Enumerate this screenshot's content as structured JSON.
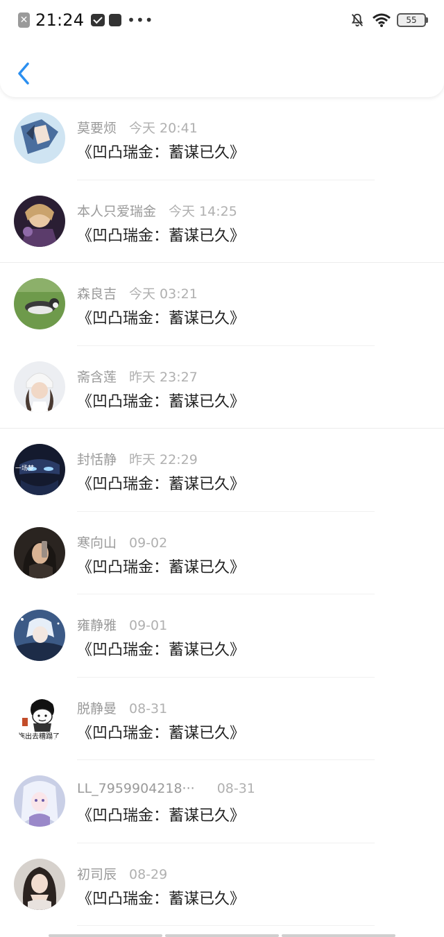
{
  "status_bar": {
    "time": "21:24",
    "battery": "55"
  },
  "header": {
    "back_icon": "chevron-left-icon",
    "accent_color": "#2b8ff0"
  },
  "comments": [
    {
      "name": "莫要烦",
      "date": "今天 20:41",
      "content": "《凹凸瑞金：蓄谋已久》"
    },
    {
      "name": "本人只爱瑞金",
      "date": "今天 14:25",
      "content": "《凹凸瑞金：蓄谋已久》"
    },
    {
      "name": "森良吉",
      "date": "今天 03:21",
      "content": "《凹凸瑞金：蓄谋已久》"
    },
    {
      "name": "斋含莲",
      "date": "昨天 23:27",
      "content": "《凹凸瑞金：蓄谋已久》"
    },
    {
      "name": "封恬静",
      "date": "昨天 22:29",
      "content": "《凹凸瑞金：蓄谋已久》",
      "avatar_text": "一场梦"
    },
    {
      "name": "寒向山",
      "date": "09-02",
      "content": "《凹凸瑞金：蓄谋已久》"
    },
    {
      "name": "雍静雅",
      "date": "09-01",
      "content": "《凹凸瑞金：蓄谋已久》"
    },
    {
      "name": "脱静曼",
      "date": "08-31",
      "content": "《凹凸瑞金：蓄谋已久》",
      "avatar_text": "拖出去糟蹋了"
    },
    {
      "name": "LL_7959904218···",
      "date": "08-31",
      "content": "《凹凸瑞金：蓄谋已久》"
    },
    {
      "name": "初司辰",
      "date": "08-29",
      "content": "《凹凸瑞金：蓄谋已久》"
    }
  ]
}
